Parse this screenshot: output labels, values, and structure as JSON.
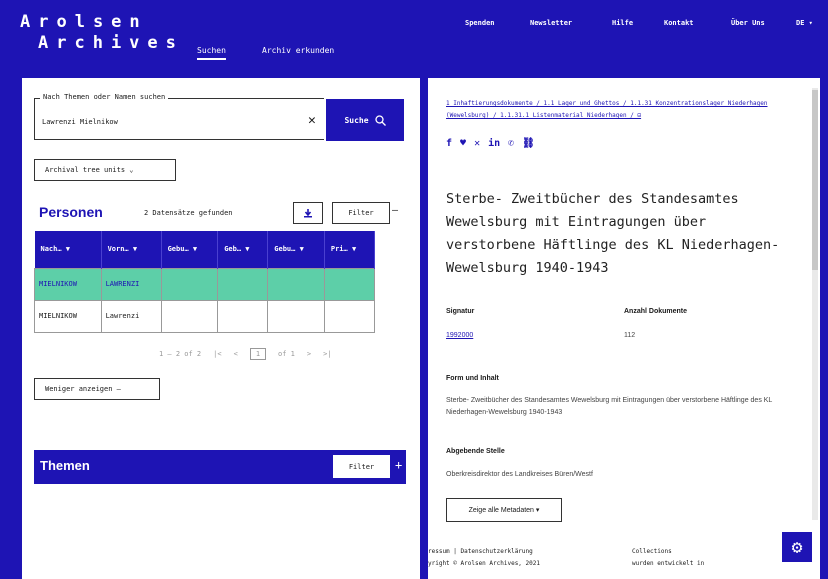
{
  "header": {
    "logo_line1": "Arolsen",
    "logo_line2": "Archives",
    "tabs": [
      {
        "label": "Suchen"
      },
      {
        "label": "Archiv erkunden"
      }
    ],
    "nav": [
      {
        "label": "Spenden"
      },
      {
        "label": "Newsletter"
      },
      {
        "label": "Hilfe"
      },
      {
        "label": "Kontakt"
      },
      {
        "label": "Über Uns"
      },
      {
        "label": "DE ▾"
      }
    ]
  },
  "search": {
    "legend": "Nach Themen oder Namen suchen",
    "value": "Lawrenzi Mielnikow",
    "clear": "✕",
    "button": "Suche"
  },
  "tree_button": "Archival tree units ⌄",
  "persons": {
    "title": "Personen",
    "found": "2 Datensätze gefunden",
    "filter": "Filter",
    "columns": [
      "Nach…",
      "Vorn…",
      "Gebu…",
      "Geb…",
      "Gebu…",
      "Pri…"
    ],
    "rows": [
      [
        "MIELNIKOW",
        "LAWRENZI",
        "",
        "",
        "",
        ""
      ],
      [
        "MIELNIKOW",
        "Lawrenzi",
        "",
        "",
        "",
        ""
      ]
    ],
    "pager": {
      "range": "1 – 2 of 2",
      "page": "1",
      "of": "of 1"
    },
    "less_button": "Weniger anzeigen —"
  },
  "themen": {
    "title": "Themen",
    "filter": "Filter",
    "plus": "+"
  },
  "detail": {
    "breadcrumbs": "1 Inhaftierungsdokumente / 1.1 Lager und Ghettos / 1.1.31 Konzentrationslager Niederhagen (Wewelsburg) / 1.1.31.1 Listenmaterial Niederhagen / ⊟",
    "social": [
      "f",
      "🐦",
      "✕",
      "in",
      "✆",
      "🔗"
    ],
    "title": "Sterbe- Zweitbücher des Standesamtes Wewelsburg mit Eintragungen über verstorbene Häftlinge des KL Niederhagen-Wewelsburg 1940-1943",
    "signatur_label": "Signatur",
    "signatur_value": "1992000",
    "anzahl_label": "Anzahl Dokumente",
    "anzahl_value": "112",
    "form_label": "Form und Inhalt",
    "form_value": "Sterbe- Zweitbücher des Standesamtes Wewelsburg mit Eintragungen über verstorbene Häftlinge des KL Niederhagen-Wewelsburg 1940-1943",
    "abgebend_label": "Abgebende Stelle",
    "abgebend_value": "Oberkreisdirektor des Landkreises Büren/Westf",
    "meta_button": "Zeige alle Metadaten ▾"
  },
  "footer": {
    "line1": "ressum  |  Datenschutzerklärung",
    "line2": "yright © Arolsen Archives, 2021",
    "right1": "Collections",
    "right2": "wurden entwickelt in"
  },
  "colors": {
    "brand": "#1e14b4",
    "selected_row": "#5dcfa8"
  }
}
